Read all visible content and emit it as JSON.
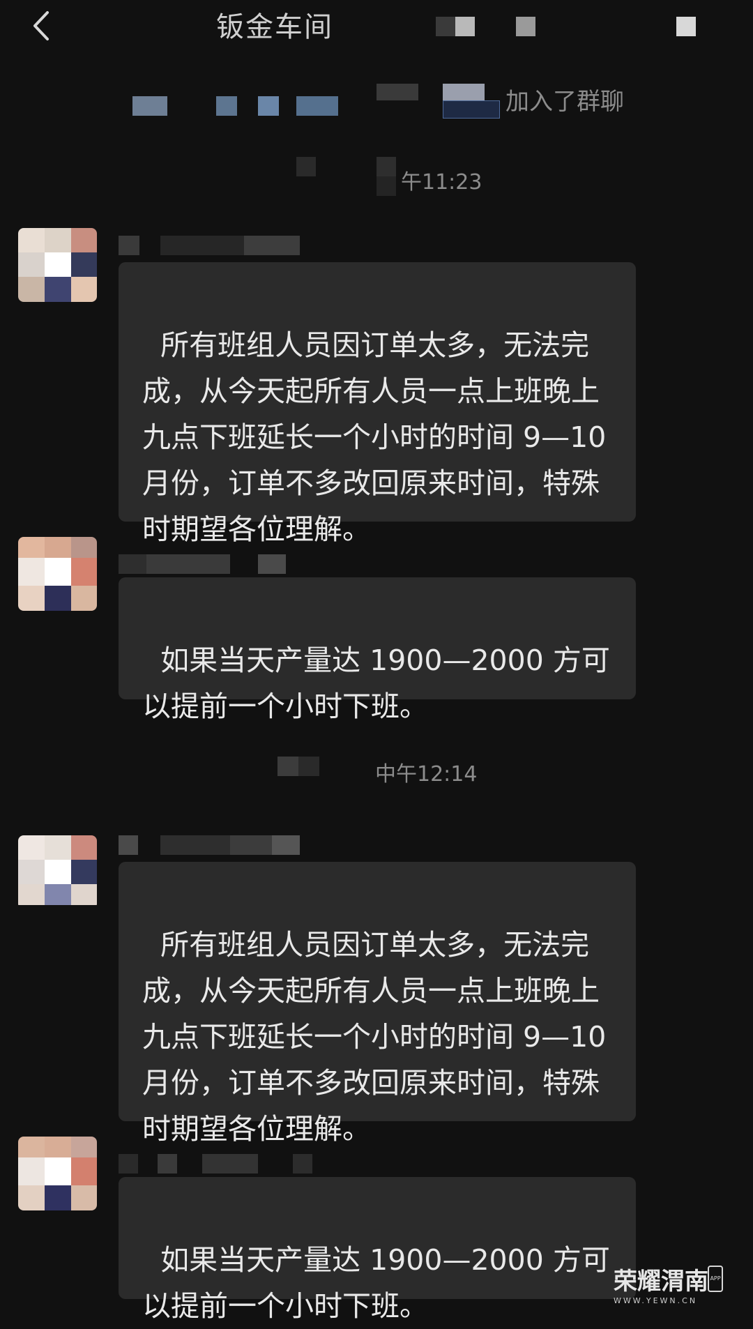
{
  "header": {
    "title": "钣金车间",
    "back_icon": "chevron-left-icon"
  },
  "system": {
    "joined_text": "加入了群聊"
  },
  "timestamps": [
    "午11:23",
    "中午12:14"
  ],
  "messages": [
    {
      "text": "所有班组人员因订单太多，无法完成，从今天起所有人员一点上班晚上九点下班延长一个小时的时间 9—10 月份，订单不多改回原来时间，特殊时期望各位理解。"
    },
    {
      "text": "如果当天产量达 1900—2000 方可以提前一个小时下班。"
    },
    {
      "text": "所有班组人员因订单太多，无法完成，从今天起所有人员一点上班晚上九点下班延长一个小时的时间 9—10 月份，订单不多改回原来时间，特殊时期望各位理解。"
    },
    {
      "text": "如果当天产量达 1900—2000 方可以提前一个小时下班。"
    }
  ],
  "watermark": {
    "main": "荣耀渭南",
    "sub": "WWW.YEWN.CN",
    "app": "APP"
  }
}
